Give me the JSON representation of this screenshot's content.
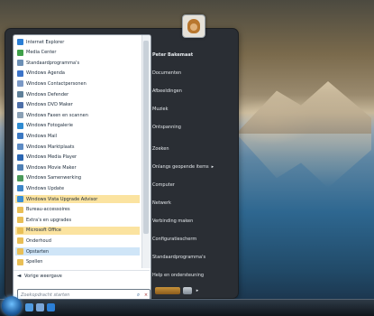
{
  "programs": [
    {
      "label": "Internet Explorer",
      "icon": "internet-explorer-icon",
      "color": "#2b7fd6",
      "state": "normal"
    },
    {
      "label": "Media Center",
      "icon": "media-center-icon",
      "color": "#3fa04a",
      "state": "normal"
    },
    {
      "label": "Standaardprogramma's",
      "icon": "default-programs-icon",
      "color": "#6c8fb5",
      "state": "normal"
    },
    {
      "label": "Windows Agenda",
      "icon": "calendar-icon",
      "color": "#3c74c9",
      "state": "normal"
    },
    {
      "label": "Windows Contactpersonen",
      "icon": "contacts-icon",
      "color": "#7b99c6",
      "state": "normal"
    },
    {
      "label": "Windows Defender",
      "icon": "defender-icon",
      "color": "#5e7f99",
      "state": "normal"
    },
    {
      "label": "Windows DVD Maker",
      "icon": "dvd-maker-icon",
      "color": "#4d6fa8",
      "state": "normal"
    },
    {
      "label": "Windows Faxen en scannen",
      "icon": "fax-scan-icon",
      "color": "#8aa0b5",
      "state": "normal"
    },
    {
      "label": "Windows Fotogalerie",
      "icon": "photo-gallery-icon",
      "color": "#2f8bd1",
      "state": "normal"
    },
    {
      "label": "Windows Mail",
      "icon": "mail-icon",
      "color": "#3b78c2",
      "state": "normal"
    },
    {
      "label": "Windows Marktplaats",
      "icon": "marketplace-icon",
      "color": "#5d8bc4",
      "state": "normal"
    },
    {
      "label": "Windows Media Player",
      "icon": "media-player-icon",
      "color": "#2a66b3",
      "state": "normal"
    },
    {
      "label": "Windows Movie Maker",
      "icon": "movie-maker-icon",
      "color": "#4e7fb4",
      "state": "normal"
    },
    {
      "label": "Windows Samenwerking",
      "icon": "meeting-space-icon",
      "color": "#4a9a5a",
      "state": "normal"
    },
    {
      "label": "Windows Update",
      "icon": "update-icon",
      "color": "#3d86c8",
      "state": "normal"
    },
    {
      "label": "Windows Vista Upgrade Advisor",
      "icon": "upgrade-advisor-icon",
      "color": "#3a8ed4",
      "state": "highlight"
    },
    {
      "label": "Bureau-accessoires",
      "icon": "folder-icon",
      "color": "#e9bf56",
      "state": "normal"
    },
    {
      "label": "Extra's en upgrades",
      "icon": "folder-icon",
      "color": "#e9bf56",
      "state": "normal"
    },
    {
      "label": "Microsoft Office",
      "icon": "folder-icon",
      "color": "#e9bf56",
      "state": "highlight"
    },
    {
      "label": "Onderhoud",
      "icon": "folder-icon",
      "color": "#e9bf56",
      "state": "normal"
    },
    {
      "label": "Opstarten",
      "icon": "folder-icon",
      "color": "#e9bf56",
      "state": "selected"
    },
    {
      "label": "Spellen",
      "icon": "folder-icon",
      "color": "#e9bf56",
      "state": "normal"
    }
  ],
  "back_label": "Vorige weergave",
  "search_placeholder": "Zoekopdracht starten",
  "right_items": [
    {
      "label": "Peter Bakemaat",
      "bold": true,
      "submenu": false
    },
    {
      "label": "Documenten",
      "submenu": false
    },
    {
      "label": "Afbeeldingen",
      "submenu": false
    },
    {
      "label": "Muziek",
      "submenu": false
    },
    {
      "label": "Ontspanning",
      "submenu": false
    },
    {
      "label": "Zoeken",
      "submenu": false
    },
    {
      "label": "Onlangs geopende items",
      "submenu": true
    },
    {
      "label": "Computer",
      "submenu": false
    },
    {
      "label": "Netwerk",
      "submenu": false
    },
    {
      "label": "Verbinding maken",
      "submenu": false
    },
    {
      "label": "Configuratiescherm",
      "submenu": false
    },
    {
      "label": "Standaardprogramma's",
      "submenu": false
    },
    {
      "label": "Help en ondersteuning",
      "submenu": false
    }
  ],
  "icons": {
    "back": "◄",
    "search": "⌕",
    "clear": "×",
    "submenu": "▸",
    "more": "▸"
  },
  "colors": {
    "highlight": "#fbe3a0",
    "selected": "#cfe5f7",
    "accent": "#2b7fd6"
  }
}
